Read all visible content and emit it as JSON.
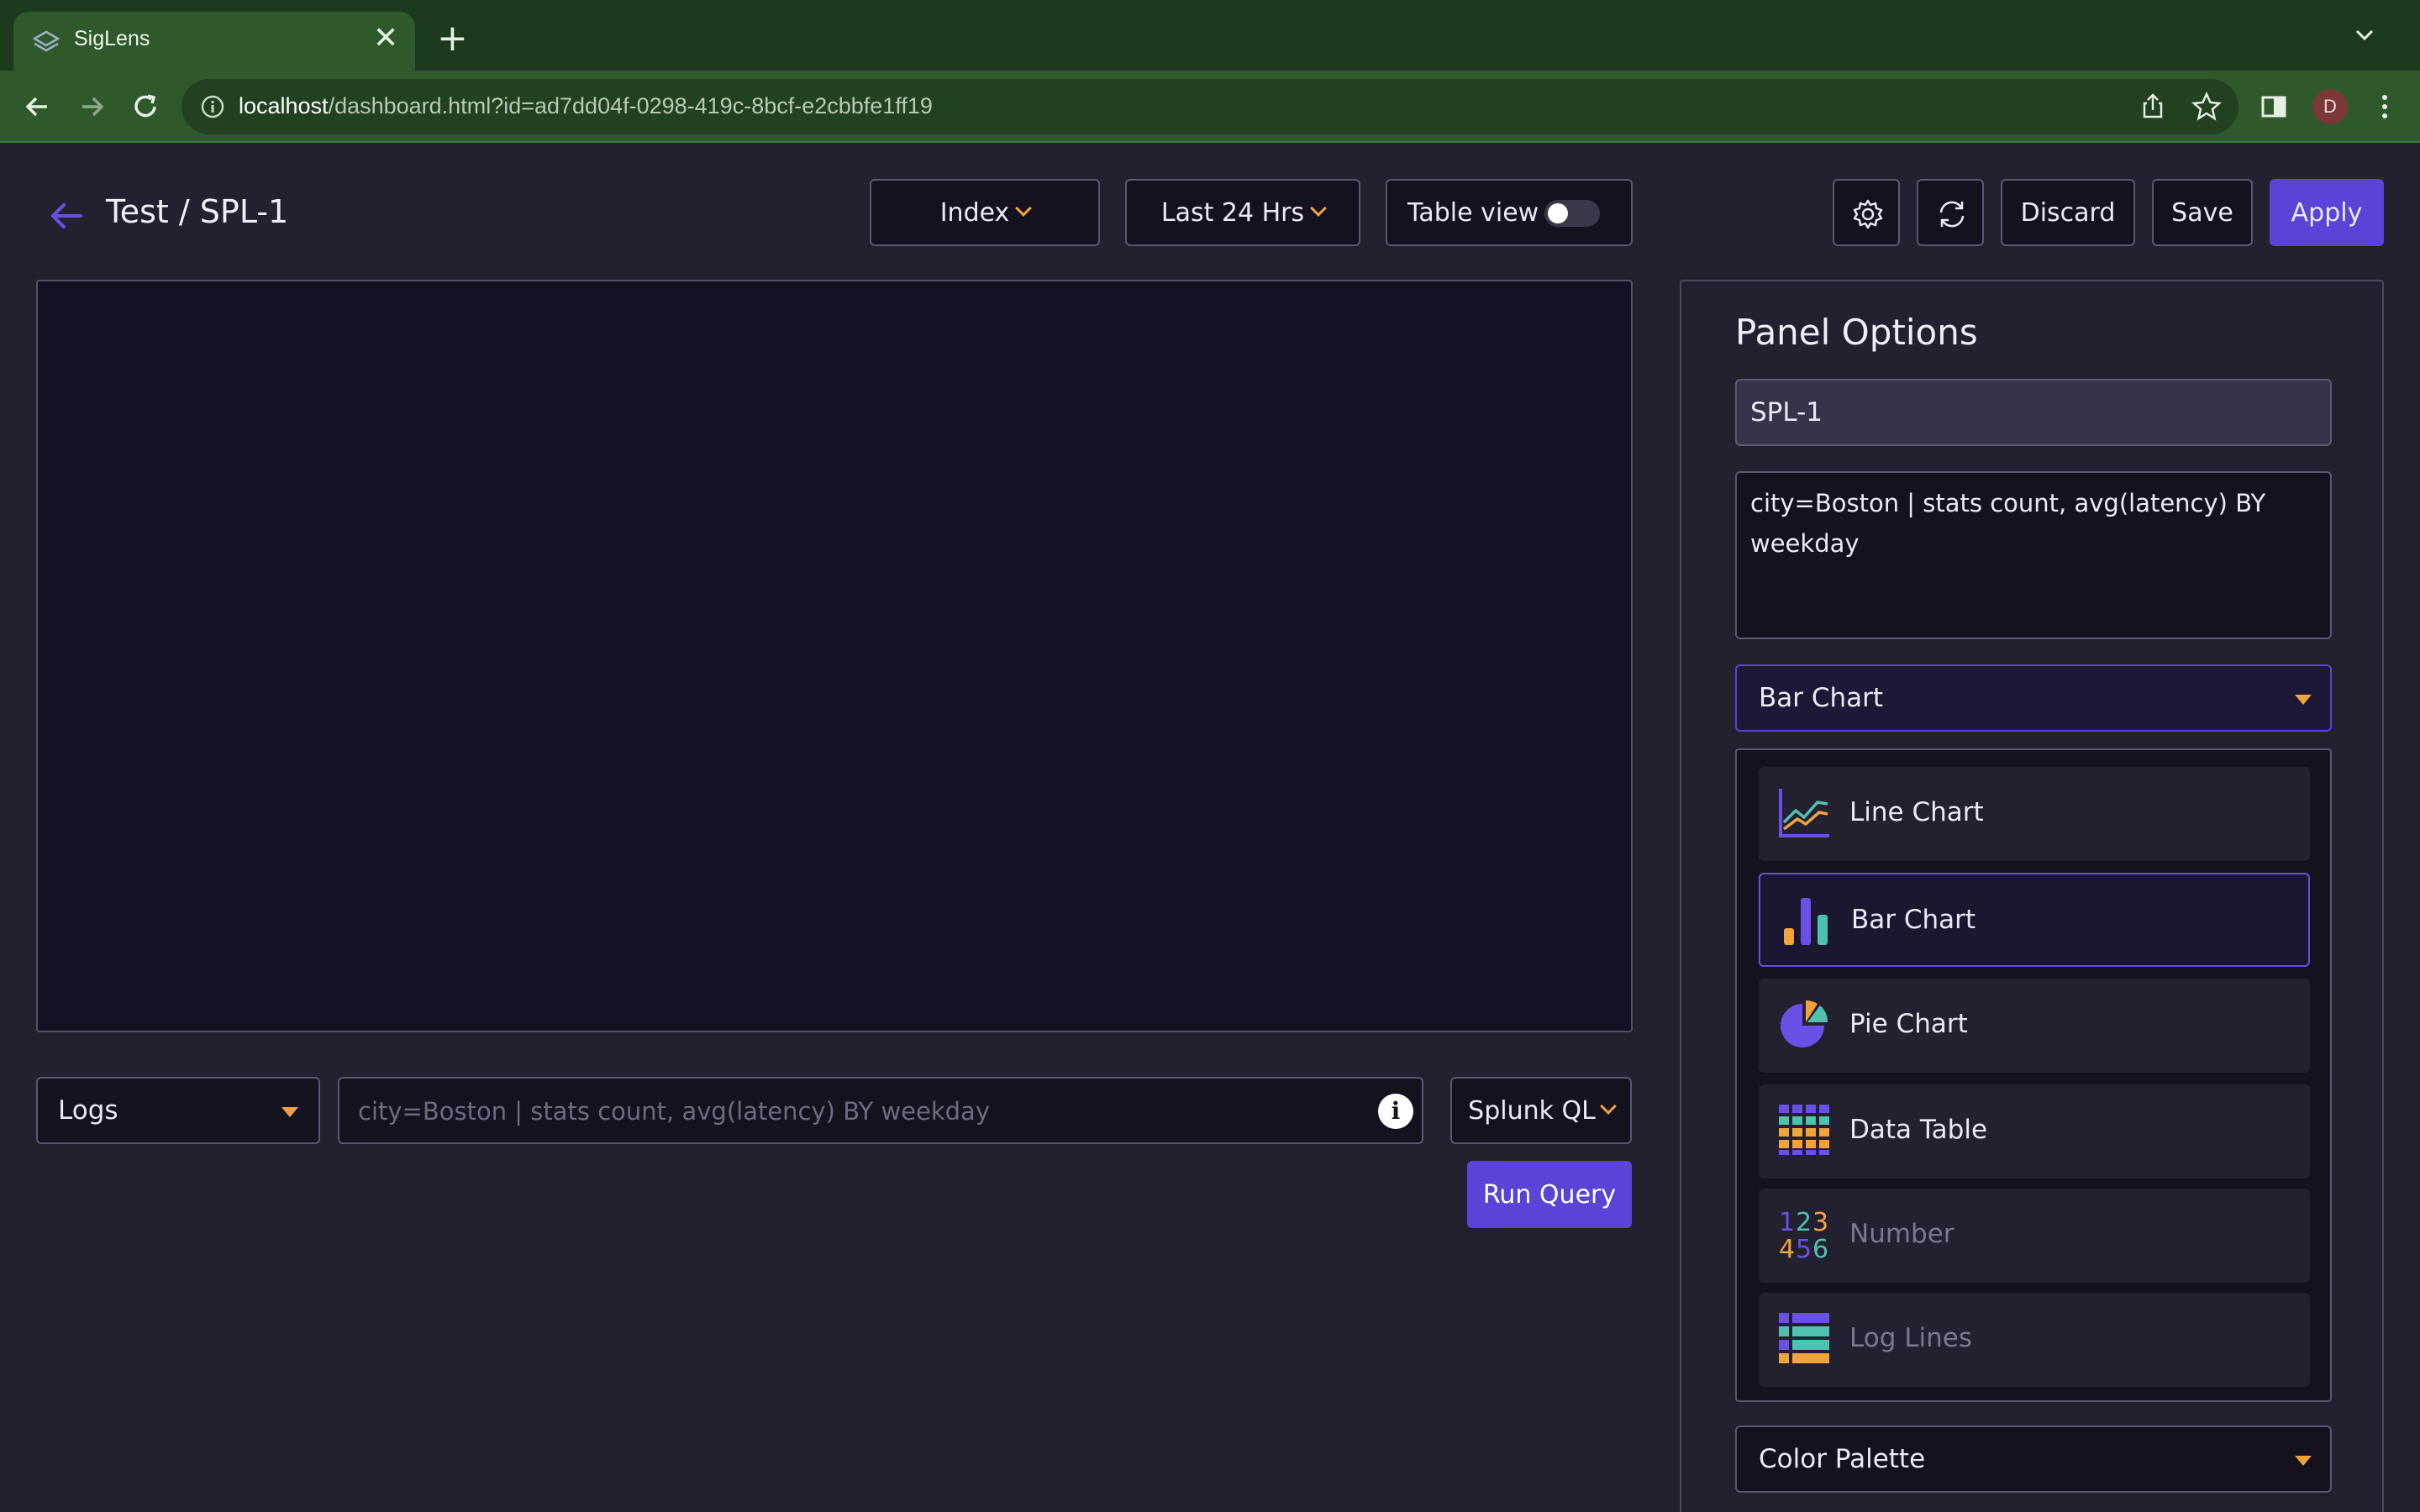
{
  "browser": {
    "tab_title": "SigLens",
    "tab_close": "✕",
    "new_tab": "+",
    "url_host": "localhost",
    "url_path": "/dashboard.html?id=ad7dd04f-0298-419c-8bcf-e2cbbfe1ff19",
    "profile_initial": "D",
    "accent_color": "#2e5a2b"
  },
  "header": {
    "title": "Test / SPL-1",
    "index_label": "Index",
    "time_range_label": "Last 24 Hrs",
    "table_view_label": "Table view",
    "table_view_enabled": false,
    "discard_label": "Discard",
    "save_label": "Save",
    "apply_label": "Apply"
  },
  "query_bar": {
    "source_select": "Logs",
    "query_placeholder": "city=Boston | stats count, avg(latency) BY weekday",
    "language_select": "Splunk QL",
    "run_query_label": "Run Query"
  },
  "panel_options": {
    "title": "Panel Options",
    "panel_name": "SPL-1",
    "query_text": "city=Boston | stats count, avg(latency) BY weekday",
    "chart_type_selected": "Bar Chart",
    "chart_types": [
      {
        "label": "Line Chart",
        "icon": "line-chart-icon",
        "selected": false,
        "disabled": false
      },
      {
        "label": "Bar Chart",
        "icon": "bar-chart-icon",
        "selected": true,
        "disabled": false
      },
      {
        "label": "Pie Chart",
        "icon": "pie-chart-icon",
        "selected": false,
        "disabled": false
      },
      {
        "label": "Data Table",
        "icon": "data-table-icon",
        "selected": false,
        "disabled": false
      },
      {
        "label": "Number",
        "icon": "number-icon",
        "selected": false,
        "disabled": true
      },
      {
        "label": "Log Lines",
        "icon": "log-lines-icon",
        "selected": false,
        "disabled": true
      }
    ],
    "color_palette_label": "Color Palette"
  },
  "colors": {
    "primary": "#5a43d6",
    "accent_orange": "#f0a43a",
    "accent_teal": "#4fc1b0",
    "background": "#23202f"
  }
}
